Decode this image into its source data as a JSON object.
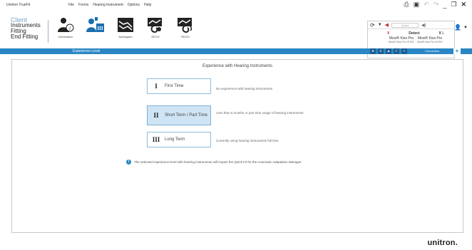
{
  "titlebar": {
    "app_title": "Unitron TrueFit",
    "menu": [
      "File",
      "Forms",
      "Hearing Instrument",
      "Options",
      "Help"
    ]
  },
  "nav": {
    "left_items": [
      "Client",
      "Instruments",
      "Fitting",
      "End Fitting"
    ],
    "tabs": [
      "Information",
      "",
      "Audiogram",
      "RECD",
      "REUG"
    ]
  },
  "device_panel": {
    "quiet_label": "Quiet",
    "left": {
      "mark": "X",
      "name": "Moxi® Kiss Pro",
      "model": "Moxi® Kiss Pro xS RIC"
    },
    "center_label": "Detect",
    "right": {
      "mark": "X",
      "side": "L",
      "name": "Moxi® Kiss Pro",
      "model": "Moxi® Kiss Pro xS RIC"
    }
  },
  "bluebar": {
    "label": "Experience Level",
    "connection_label": "Connection"
  },
  "main": {
    "title": "Experience with Hearing Instruments",
    "options": [
      {
        "roman": "I",
        "label": "First Time",
        "desc": "No experience with hearing instruments",
        "selected": false
      },
      {
        "roman": "II",
        "label": "Short Term / Part Time",
        "desc": "Less than 6 months or part time usage of hearing instruments",
        "selected": true
      },
      {
        "roman": "III",
        "label": "Long Term",
        "desc": "Currently using hearing instruments full time",
        "selected": false
      }
    ],
    "note": "The selected experience level with hearing instruments will impact the Quick Fit for the Automatic Adaptation Manager."
  },
  "brand": "unitron."
}
